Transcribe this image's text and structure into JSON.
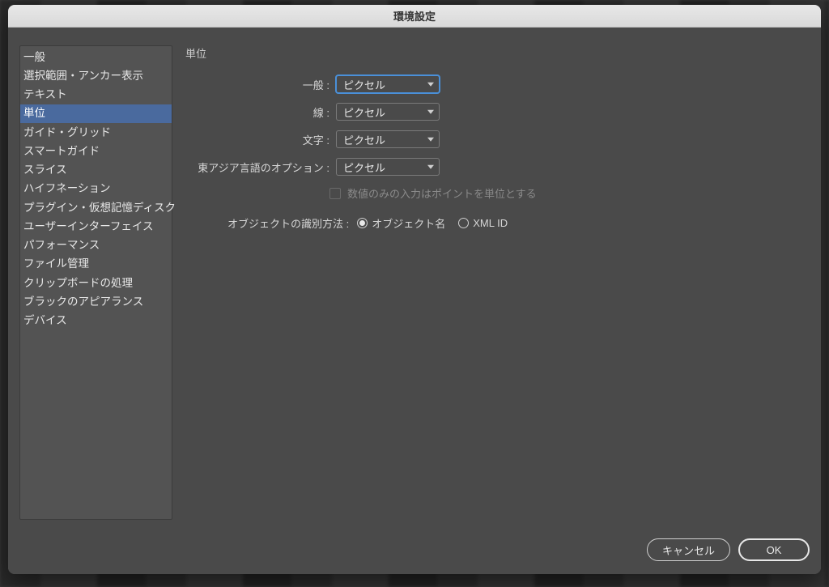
{
  "dialog": {
    "title": "環境設定"
  },
  "sidebar": {
    "items": [
      {
        "label": "一般",
        "active": false
      },
      {
        "label": "選択範囲・アンカー表示",
        "active": false
      },
      {
        "label": "テキスト",
        "active": false
      },
      {
        "label": "単位",
        "active": true
      },
      {
        "label": "ガイド・グリッド",
        "active": false
      },
      {
        "label": "スマートガイド",
        "active": false
      },
      {
        "label": "スライス",
        "active": false
      },
      {
        "label": "ハイフネーション",
        "active": false
      },
      {
        "label": "プラグイン・仮想記憶ディスク",
        "active": false
      },
      {
        "label": "ユーザーインターフェイス",
        "active": false
      },
      {
        "label": "パフォーマンス",
        "active": false
      },
      {
        "label": "ファイル管理",
        "active": false
      },
      {
        "label": "クリップボードの処理",
        "active": false
      },
      {
        "label": "ブラックのアピアランス",
        "active": false
      },
      {
        "label": "デバイス",
        "active": false
      }
    ]
  },
  "content": {
    "section_title": "単位",
    "fields": {
      "general": {
        "label": "一般 :",
        "value": "ピクセル",
        "focused": true
      },
      "line": {
        "label": "線 :",
        "value": "ピクセル",
        "focused": false
      },
      "text": {
        "label": "文字 :",
        "value": "ピクセル",
        "focused": false
      },
      "east_asian": {
        "label": "東アジア言語のオプション :",
        "value": "ピクセル",
        "focused": false
      }
    },
    "checkbox": {
      "label": "数値のみの入力はポイントを単位とする",
      "checked": false,
      "disabled": true
    },
    "identify": {
      "label": "オブジェクトの識別方法 :",
      "options": [
        {
          "label": "オブジェクト名",
          "checked": true
        },
        {
          "label": "XML ID",
          "checked": false
        }
      ]
    }
  },
  "footer": {
    "cancel": "キャンセル",
    "ok": "OK"
  }
}
